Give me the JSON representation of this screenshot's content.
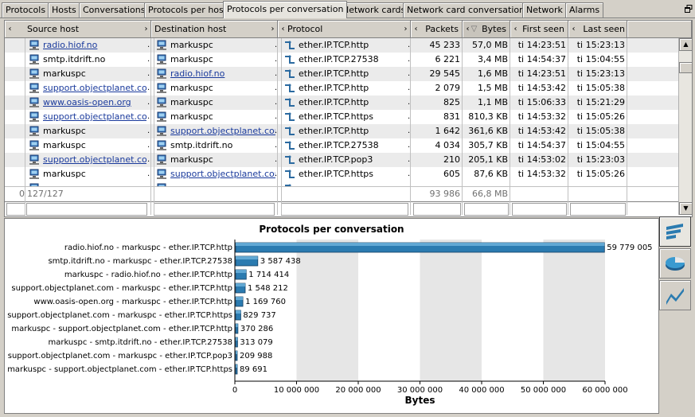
{
  "tabs": [
    {
      "label": "Protocols",
      "active": false
    },
    {
      "label": "Hosts",
      "active": false
    },
    {
      "label": "Conversations",
      "active": false
    },
    {
      "label": "Protocols per host",
      "active": false
    },
    {
      "label": "Protocols per conversation",
      "active": true
    },
    {
      "label": "Network cards",
      "active": false
    },
    {
      "label": "Network card conversations",
      "active": false
    },
    {
      "label": "Network",
      "active": false
    },
    {
      "label": "Alarms",
      "active": false
    }
  ],
  "table": {
    "columns": {
      "source_host": "Source host",
      "destination_host": "Destination host",
      "protocol": "Protocol",
      "packets": "Packets",
      "bytes": "Bytes",
      "first_seen": "First seen",
      "last_seen": "Last seen"
    },
    "rows": [
      {
        "src": "radio.hiof.no",
        "src_link": true,
        "dst": "markuspc",
        "dst_link": false,
        "protocol": "ether.IP.TCP.http",
        "packets": "45 233",
        "bytes": "57,0 MB",
        "first": "ti 14:23:51",
        "last": "ti 15:23:13"
      },
      {
        "src": "smtp.itdrift.no",
        "src_link": false,
        "dst": "markuspc",
        "dst_link": false,
        "protocol": "ether.IP.TCP.27538",
        "packets": "6 221",
        "bytes": "3,4 MB",
        "first": "ti 14:54:37",
        "last": "ti 15:04:55"
      },
      {
        "src": "markuspc",
        "src_link": false,
        "dst": "radio.hiof.no",
        "dst_link": true,
        "protocol": "ether.IP.TCP.http",
        "packets": "29 545",
        "bytes": "1,6 MB",
        "first": "ti 14:23:51",
        "last": "ti 15:23:13"
      },
      {
        "src": "support.objectplanet.com",
        "src_link": true,
        "dst": "markuspc",
        "dst_link": false,
        "protocol": "ether.IP.TCP.http",
        "packets": "2 079",
        "bytes": "1,5 MB",
        "first": "ti 14:53:42",
        "last": "ti 15:05:38"
      },
      {
        "src": "www.oasis-open.org",
        "src_link": true,
        "dst": "markuspc",
        "dst_link": false,
        "protocol": "ether.IP.TCP.http",
        "packets": "825",
        "bytes": "1,1 MB",
        "first": "ti 15:06:33",
        "last": "ti 15:21:29"
      },
      {
        "src": "support.objectplanet.com",
        "src_link": true,
        "dst": "markuspc",
        "dst_link": false,
        "protocol": "ether.IP.TCP.https",
        "packets": "831",
        "bytes": "810,3 KB",
        "first": "ti 14:53:32",
        "last": "ti 15:05:26"
      },
      {
        "src": "markuspc",
        "src_link": false,
        "dst": "support.objectplanet.com",
        "dst_link": true,
        "protocol": "ether.IP.TCP.http",
        "packets": "1 642",
        "bytes": "361,6 KB",
        "first": "ti 14:53:42",
        "last": "ti 15:05:38"
      },
      {
        "src": "markuspc",
        "src_link": false,
        "dst": "smtp.itdrift.no",
        "dst_link": false,
        "protocol": "ether.IP.TCP.27538",
        "packets": "4 034",
        "bytes": "305,7 KB",
        "first": "ti 14:54:37",
        "last": "ti 15:04:55"
      },
      {
        "src": "support.objectplanet.com",
        "src_link": true,
        "dst": "markuspc",
        "dst_link": false,
        "protocol": "ether.IP.TCP.pop3",
        "packets": "210",
        "bytes": "205,1 KB",
        "first": "ti 14:53:02",
        "last": "ti 15:23:03"
      },
      {
        "src": "markuspc",
        "src_link": false,
        "dst": "support.objectplanet.com",
        "dst_link": true,
        "protocol": "ether.IP.TCP.https",
        "packets": "605",
        "bytes": "87,6 KB",
        "first": "ti 14:53:32",
        "last": "ti 15:05:26"
      }
    ],
    "summary": {
      "index": "0",
      "count": "127/127",
      "packets": "93 986",
      "bytes": "66,8 MB"
    }
  },
  "chart_data": {
    "type": "bar",
    "orientation": "horizontal",
    "title": "Protocols per conversation",
    "xlabel": "Bytes",
    "ylabel": "",
    "xlim": [
      0,
      60000000
    ],
    "xticks": [
      "0",
      "10 000 000",
      "20 000 000",
      "30 000 000",
      "40 000 000",
      "50 000 000",
      "60 000 000"
    ],
    "categories": [
      "radio.hiof.no - markuspc - ether.IP.TCP.http",
      "smtp.itdrift.no - markuspc - ether.IP.TCP.27538",
      "markuspc - radio.hiof.no - ether.IP.TCP.http",
      "support.objectplanet.com - markuspc - ether.IP.TCP.http",
      "www.oasis-open.org - markuspc - ether.IP.TCP.http",
      "support.objectplanet.com - markuspc - ether.IP.TCP.https",
      "markuspc - support.objectplanet.com - ether.IP.TCP.http",
      "markuspc - smtp.itdrift.no - ether.IP.TCP.27538",
      "support.objectplanet.com - markuspc - ether.IP.TCP.pop3",
      "markuspc - support.objectplanet.com - ether.IP.TCP.https"
    ],
    "values": [
      59779005,
      3587438,
      1714414,
      1548212,
      1169760,
      829737,
      370286,
      313079,
      209988,
      89691
    ],
    "value_labels": [
      "59 779 005",
      "3 587 438",
      "1 714 414",
      "1 548 212",
      "1 169 760",
      "829 737",
      "370 286",
      "313 079",
      "209 988",
      "89 691"
    ],
    "grid": "alternating vertical bands",
    "bar_color": "#2b7bb0"
  },
  "side_buttons": [
    "bar-chart-icon",
    "pie-chart-icon",
    "line-chart-icon"
  ]
}
